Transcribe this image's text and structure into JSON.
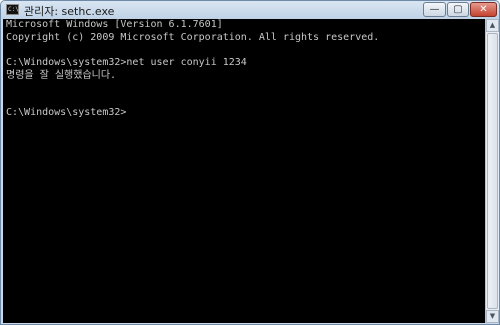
{
  "window": {
    "title": "관리자: sethc.exe",
    "icon_text": "C:\\",
    "controls": {
      "minimize": "—",
      "maximize": "▢",
      "close": "✕"
    }
  },
  "console": {
    "lines": [
      "Microsoft Windows [Version 6.1.7601]",
      "Copyright (c) 2009 Microsoft Corporation. All rights reserved.",
      "C:\\Windows\\system32>net user conyii 1234",
      "명령을 잘 실행했습니다.",
      "C:\\Windows\\system32>"
    ],
    "text_color": "#c8c8c8",
    "background_color": "#000000"
  },
  "scrollbar": {
    "up_arrow": "▲",
    "down_arrow": "▼"
  }
}
